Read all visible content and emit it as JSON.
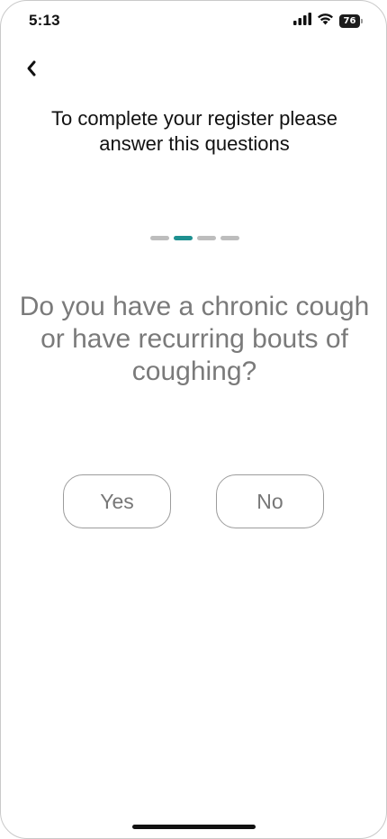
{
  "status_bar": {
    "time": "5:13",
    "battery_level": "76",
    "icons": [
      "cellular-signal-icon",
      "wifi-icon",
      "battery-icon"
    ]
  },
  "nav": {
    "back_icon": "chevron-left-icon"
  },
  "heading": "To complete your register please answer this questions",
  "progress": {
    "total_steps": 4,
    "current_step": 2,
    "active_color": "#1e9090",
    "inactive_color": "#bdbdbd"
  },
  "question": "Do you have a chronic cough or have recurring bouts of coughing?",
  "answers": {
    "yes_label": "Yes",
    "no_label": "No"
  }
}
